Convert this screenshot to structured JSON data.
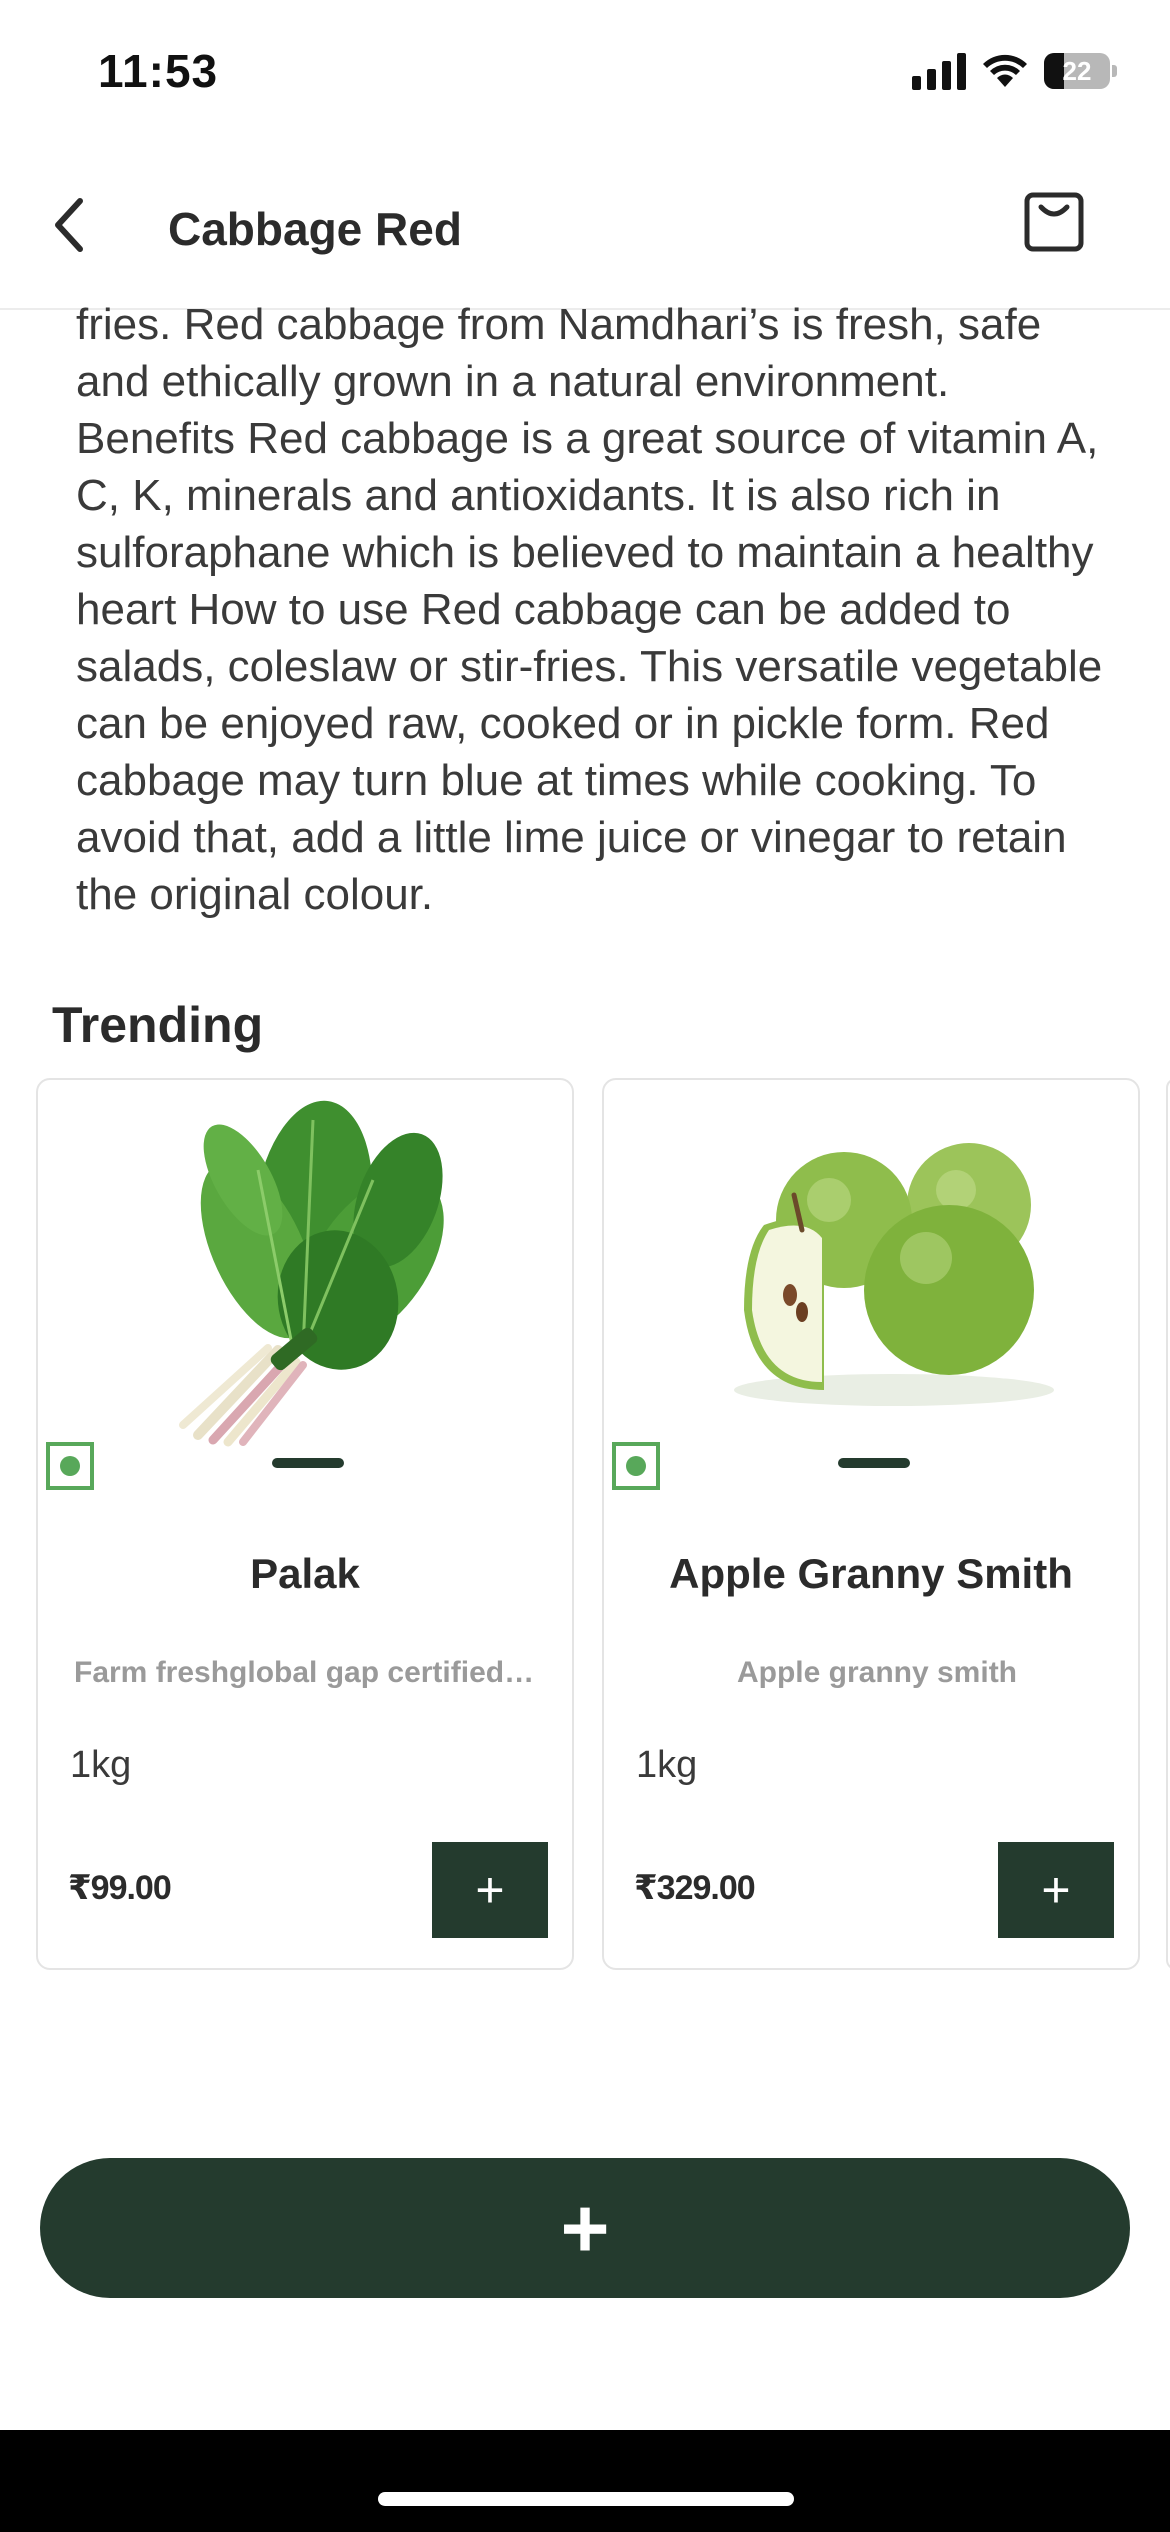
{
  "status_bar": {
    "time": "11:53",
    "battery": "22",
    "icons": [
      "signal-icon",
      "wifi-icon",
      "battery-icon"
    ]
  },
  "header": {
    "title": "Cabbage Red",
    "back_icon": "chevron-left-icon",
    "bag_icon": "shopping-bag-icon"
  },
  "description": "fries. Red cabbage from Namdhari’s is fresh, safe and ethically grown in a natural environment. Benefits Red cabbage is a great source of vitamin A, C, K, minerals and antioxidants. It is also rich in sulforaphane which is believed to maintain a healthy heart How to use Red cabbage can be added to salads, coleslaw or stir-fries. This versatile vegetable can be enjoyed raw, cooked or in pickle form. Red cabbage may turn blue at times while cooking. To avoid that, add a little lime juice or vinegar to retain the original colour.",
  "trending": {
    "title": "Trending",
    "products": [
      {
        "name": "Palak",
        "description": "Farm freshglobal gap certifiedsup...",
        "quantity": "1kg",
        "price": "₹99.00",
        "add_label": "+",
        "image": "spinach-image"
      },
      {
        "name": "Apple Granny Smith",
        "description": "Apple granny smith",
        "quantity": "1kg",
        "price": "₹329.00",
        "add_label": "+",
        "image": "green-apples-image"
      }
    ]
  },
  "add_button_label": "+",
  "colors": {
    "primary": "#243b2e",
    "veg_green": "#58a85a",
    "muted_text": "#9a9a9a"
  }
}
